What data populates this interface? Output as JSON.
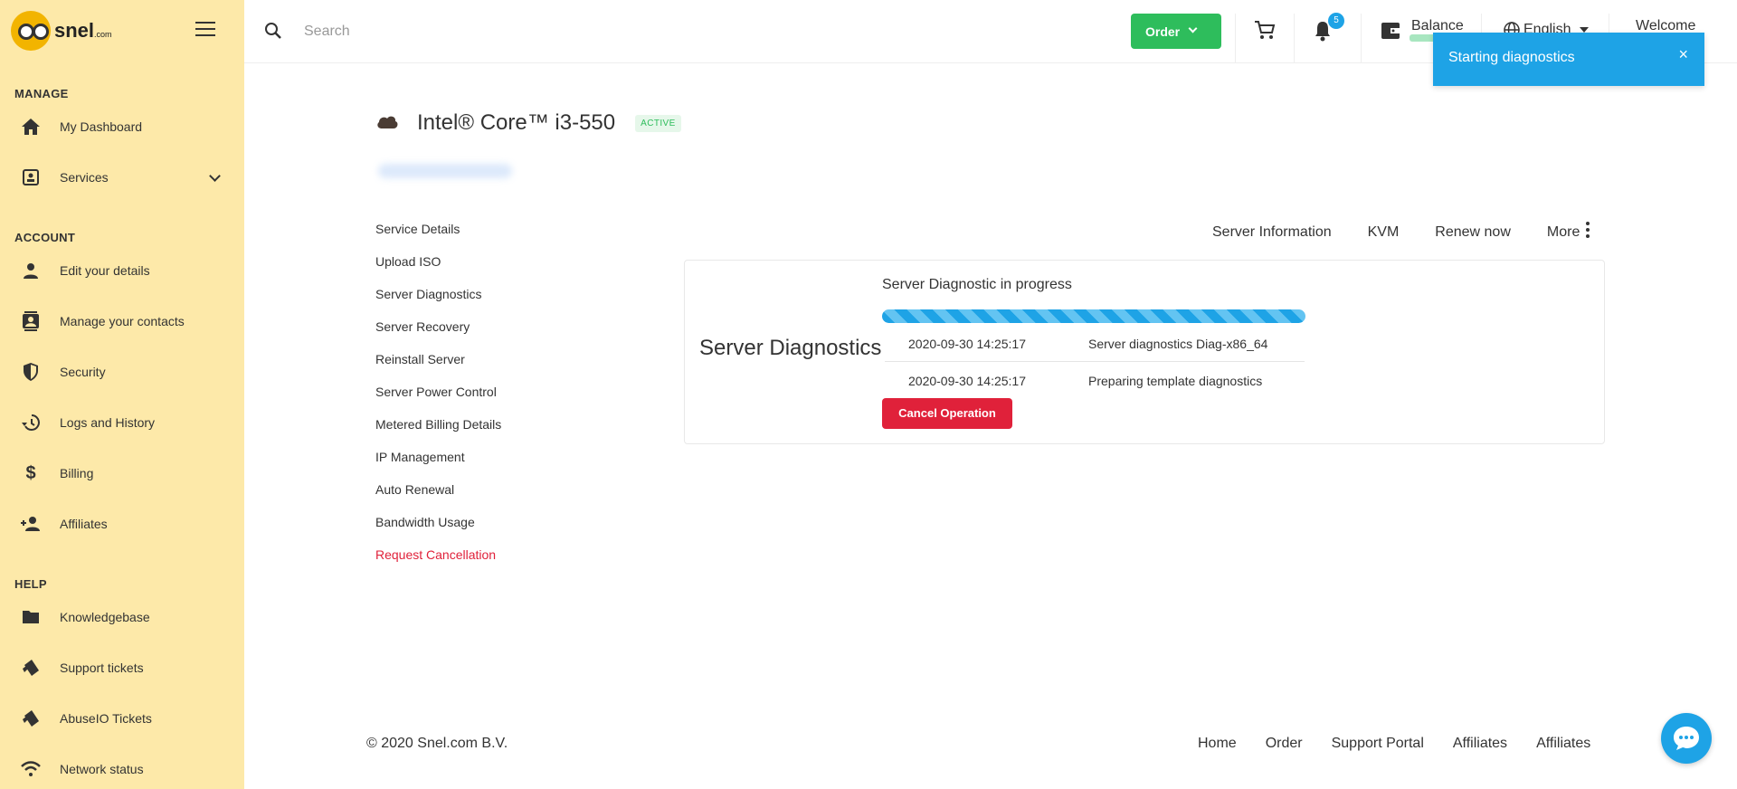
{
  "sidebar": {
    "brand": "snel",
    "brand_suffix": ".com",
    "sections": [
      {
        "title": "MANAGE",
        "items": [
          {
            "label": "My Dashboard",
            "icon": "home-icon"
          },
          {
            "label": "Services",
            "icon": "services-icon",
            "expandable": true
          }
        ]
      },
      {
        "title": "ACCOUNT",
        "items": [
          {
            "label": "Edit your details",
            "icon": "person-icon"
          },
          {
            "label": "Manage your contacts",
            "icon": "contacts-icon"
          },
          {
            "label": "Security",
            "icon": "shield-icon"
          },
          {
            "label": "Logs and History",
            "icon": "history-icon"
          },
          {
            "label": "Billing",
            "icon": "dollar-icon"
          },
          {
            "label": "Affiliates",
            "icon": "group-icon"
          }
        ]
      },
      {
        "title": "HELP",
        "items": [
          {
            "label": "Knowledgebase",
            "icon": "book-icon"
          },
          {
            "label": "Support tickets",
            "icon": "ticket-icon"
          },
          {
            "label": "AbuseIO Tickets",
            "icon": "ticket-icon"
          },
          {
            "label": "Network status",
            "icon": "wifi-icon"
          }
        ]
      }
    ]
  },
  "topbar": {
    "search_placeholder": "Search",
    "order_label": "Order",
    "notification_count": "5",
    "balance_label": "Balance",
    "language": "English",
    "welcome": "Welcome"
  },
  "toast": {
    "message": "Starting diagnostics",
    "close": "×"
  },
  "page": {
    "title": "Intel® Core™ i3-550",
    "status": "ACTIVE"
  },
  "submenu": [
    "Service Details",
    "Upload ISO",
    "Server Diagnostics",
    "Server Recovery",
    "Reinstall Server",
    "Server Power Control",
    "Metered Billing Details",
    "IP Management",
    "Auto Renewal",
    "Bandwidth Usage",
    "Request Cancellation"
  ],
  "tabs": {
    "server_info": "Server Information",
    "kvm": "KVM",
    "renew": "Renew now",
    "more": "More"
  },
  "diagnostics": {
    "title": "Server Diagnostics",
    "progress_title": "Server Diagnostic in progress",
    "progress": 1.0,
    "log": [
      {
        "timestamp": "2020-09-30 14:25:17",
        "message": "Server diagnostics Diag-x86_64"
      },
      {
        "timestamp": "2020-09-30 14:25:17",
        "message": "Preparing template diagnostics"
      }
    ],
    "cancel_label": "Cancel Operation"
  },
  "footer": {
    "copyright": "© 2020 Snel.com B.V.",
    "links": [
      "Home",
      "Order",
      "Support Portal",
      "Affiliates",
      "Affiliates"
    ]
  },
  "colors": {
    "sidebar_bg": "#fde9a9",
    "accent_blue": "#1ea3e6",
    "order_green": "#2ebd5c",
    "danger_red": "#e0213a"
  }
}
